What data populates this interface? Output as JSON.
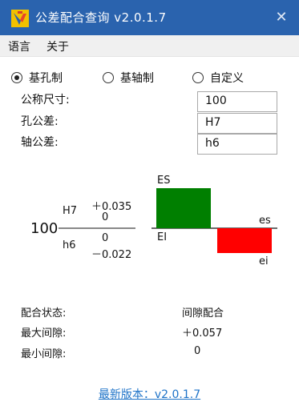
{
  "window": {
    "title": "公差配合查询  v2.0.1.7",
    "close_symbol": "✕"
  },
  "menu": {
    "items": [
      "语言",
      "关于"
    ]
  },
  "radios": [
    {
      "label": "基孔制",
      "checked": true
    },
    {
      "label": "基轴制",
      "checked": false
    },
    {
      "label": "自定义",
      "checked": false
    }
  ],
  "fields": {
    "nominal_label": "公称尺寸:",
    "nominal_value": "100",
    "hole_label": "孔公差:",
    "hole_value": "H7",
    "shaft_label": "轴公差:",
    "shaft_value": "h6"
  },
  "diagram": {
    "nominal": "100",
    "hole_code": "H7",
    "hole_upper": "＋0.035",
    "hole_lower": "0",
    "shaft_code": "h6",
    "shaft_upper": "0",
    "shaft_lower": "－0.022",
    "label_ES": "ES",
    "label_EI": "EI",
    "label_es": "es",
    "label_ei": "ei",
    "hole_color": "#007f00",
    "shaft_color": "#ff0000"
  },
  "results": {
    "state_label": "配合状态:",
    "state_value": "间隙配合",
    "max_label": "最大间隙:",
    "max_value": "＋0.057",
    "min_label": "最小间隙:",
    "min_value": "0"
  },
  "footer": {
    "latest_version": "最新版本：v2.0.1.7"
  },
  "colors": {
    "titlebar": "#2a63ae",
    "link": "#1e73c8"
  }
}
